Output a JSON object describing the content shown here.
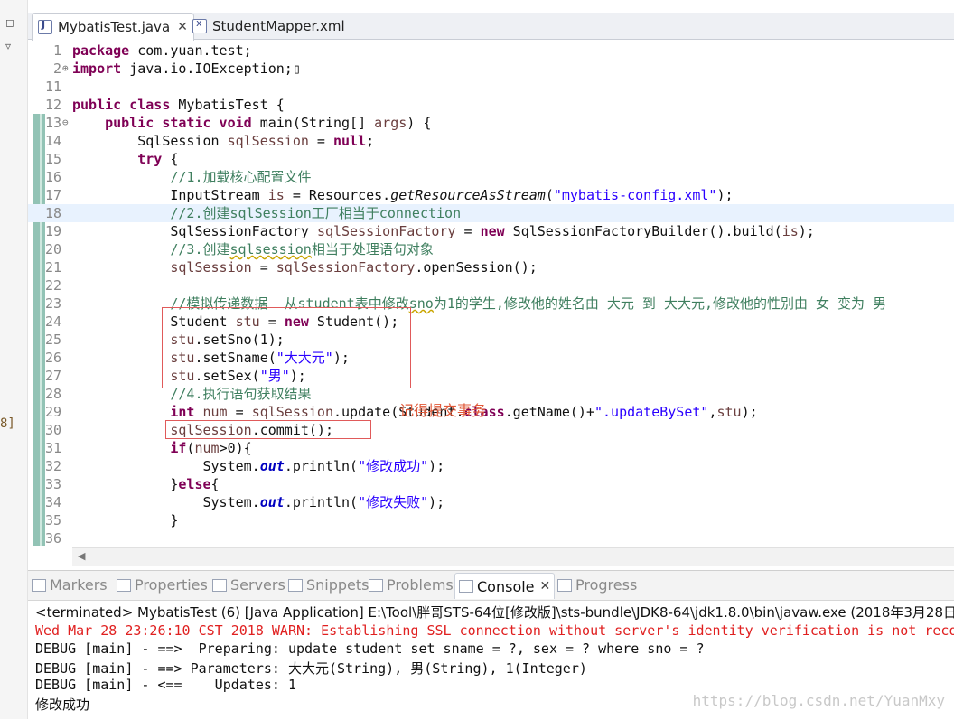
{
  "editor": {
    "tabs": [
      {
        "label": "MybatisTest.java",
        "icon": "java-file-icon",
        "active": true,
        "close": "✕"
      },
      {
        "label": "StudentMapper.xml",
        "icon": "xml-file-icon",
        "active": false
      }
    ],
    "lines": [
      {
        "n": "1",
        "html": "<span class=\"kw\">package</span> com.yuan.test;"
      },
      {
        "n": "2",
        "fold": "⊕",
        "html": "<span class=\"kw\">import</span> java.io.IOException;▯"
      },
      {
        "n": "11",
        "html": ""
      },
      {
        "n": "12",
        "html": "<span class=\"kw\">public class</span> MybatisTest {"
      },
      {
        "n": "13",
        "fold": "⊖",
        "html": "    <span class=\"kw\">public static void</span> main(String[] <span class=\"vr\">args</span>) {"
      },
      {
        "n": "14",
        "html": "        SqlSession <span class=\"vr\">sqlSession</span> = <span class=\"kw\">null</span>;"
      },
      {
        "n": "15",
        "html": "        <span class=\"kw\">try</span> {"
      },
      {
        "n": "16",
        "html": "            <span class=\"cm\">//1.加载核心配置文件</span>"
      },
      {
        "n": "17",
        "html": "            InputStream <span class=\"vr\">is</span> = Resources.<span class=\"it\">getResourceAsStream</span>(<span class=\"st\">\"mybatis-config.xml\"</span>);"
      },
      {
        "n": "18",
        "cur": true,
        "html": "            <span class=\"cm\">//2.创建sqlSession工厂相当于connection</span>"
      },
      {
        "n": "19",
        "html": "            SqlSessionFactory <span class=\"vr\">sqlSessionFactory</span> = <span class=\"kw\">new</span> SqlSessionFactoryBuilder().build(<span class=\"vr\">is</span>);"
      },
      {
        "n": "20",
        "html": "            <span class=\"cm\">//3.创建<span class=\"sq\">sqlsession</span>相当于处理语句对象</span>"
      },
      {
        "n": "21",
        "html": "            <span class=\"vr\">sqlSession</span> = <span class=\"vr\">sqlSessionFactory</span>.openSession();"
      },
      {
        "n": "22",
        "html": ""
      },
      {
        "n": "23",
        "html": "            <span class=\"cm\">//模拟传递数据  从student表中修改<span class=\"sq\">sno</span>为1的学生,修改他的姓名由 大元 到 大大元,修改他的性别由 女 变为 男</span>"
      },
      {
        "n": "24",
        "html": "            Student <span class=\"vr\">stu</span> = <span class=\"kw\">new</span> Student();"
      },
      {
        "n": "25",
        "html": "            <span class=\"vr\">stu</span>.setSno(1);"
      },
      {
        "n": "26",
        "html": "            <span class=\"vr\">stu</span>.setSname(<span class=\"st\">\"大大元\"</span>);"
      },
      {
        "n": "27",
        "html": "            <span class=\"vr\">stu</span>.setSex(<span class=\"st\">\"男\"</span>);"
      },
      {
        "n": "28",
        "html": "            <span class=\"cm\">//4.执行语句获取结果</span>"
      },
      {
        "n": "29",
        "html": "            <span class=\"kw\">int</span> <span class=\"vr\">num</span> = <span class=\"vr\">sqlSession</span>.update(Student.<span class=\"kw\">class</span>.getName()+<span class=\"st\">\".updateBySet\"</span>,<span class=\"vr\">stu</span>);"
      },
      {
        "n": "30",
        "html": "            <span class=\"vr\">sqlSession</span>.commit();"
      },
      {
        "n": "31",
        "html": "            <span class=\"kw\">if</span>(<span class=\"vr\">num</span>>0){"
      },
      {
        "n": "32",
        "html": "                System.<span class=\"fd it\"><b>out</b></span>.println(<span class=\"st\">\"修改成功\"</span>);"
      },
      {
        "n": "33",
        "html": "            }<span class=\"kw\">else</span>{"
      },
      {
        "n": "34",
        "html": "                System.<span class=\"fd it\"><b>out</b></span>.println(<span class=\"st\">\"修改失败\"</span>);"
      },
      {
        "n": "35",
        "html": "            }"
      },
      {
        "n": "36",
        "html": ""
      }
    ],
    "annotation": "记得提交事务",
    "left_marker": "8]"
  },
  "console": {
    "tabs": [
      {
        "label": "Markers",
        "active": false
      },
      {
        "label": "Properties",
        "active": false
      },
      {
        "label": "Servers",
        "active": false
      },
      {
        "label": "Snippets",
        "active": false
      },
      {
        "label": "Problems",
        "active": false
      },
      {
        "label": "Console",
        "active": true,
        "close": "✕"
      },
      {
        "label": "Progress",
        "active": false
      }
    ],
    "terminated": "<terminated> MybatisTest (6) [Java Application] E:\\Tool\\胖哥STS-64位[修改版]\\sts-bundle\\JDK8-64\\jdk1.8.0\\bin\\javaw.exe (2018年3月28日 下午",
    "lines": [
      {
        "text": "Wed Mar 28 23:26:10 CST 2018 WARN: Establishing SSL connection without server's identity verification is not reco",
        "warn": true
      },
      {
        "text": "DEBUG [main] - ==>  Preparing: update student set sname = ?, sex = ? where sno = ?",
        "warn": false
      },
      {
        "text": "DEBUG [main] - ==> Parameters: 大大元(String), 男(String), 1(Integer)",
        "warn": false
      },
      {
        "text": "DEBUG [main] - <==    Updates: 1",
        "warn": false
      },
      {
        "text": "修改成功",
        "warn": false
      }
    ],
    "watermark": "https://blog.csdn.net/YuanMxy"
  }
}
